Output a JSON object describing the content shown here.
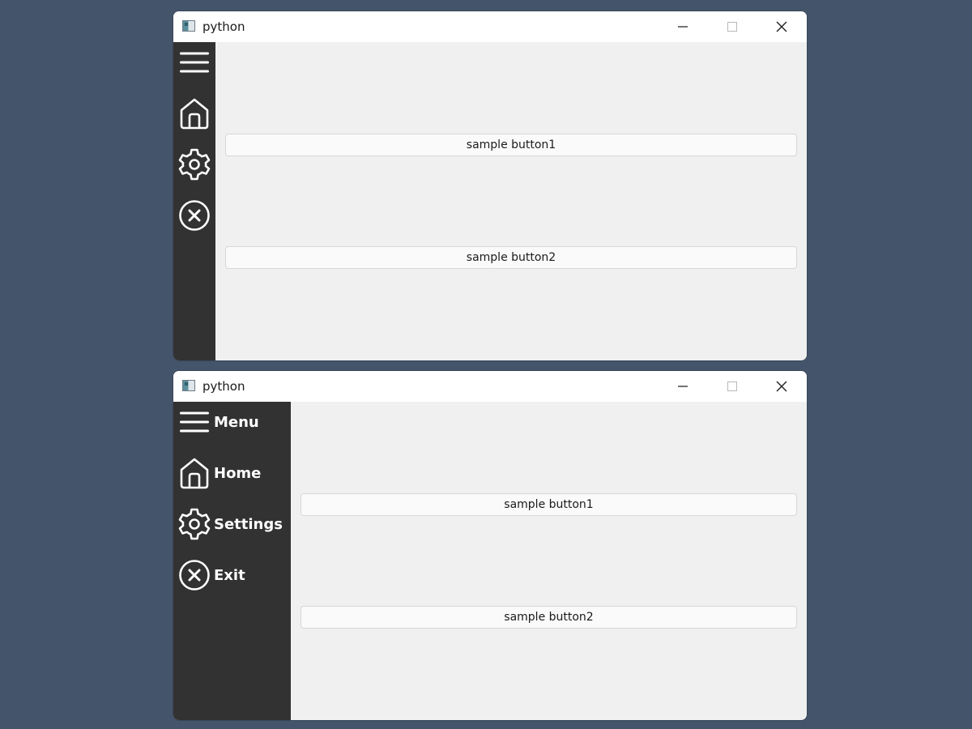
{
  "windows": [
    {
      "title": "python",
      "sidebar_state": "collapsed",
      "nav": [
        {
          "icon": "menu-icon",
          "label": ""
        },
        {
          "icon": "home-icon",
          "label": ""
        },
        {
          "icon": "settings-icon",
          "label": ""
        },
        {
          "icon": "exit-icon",
          "label": ""
        }
      ],
      "buttons": [
        "sample button1",
        "sample button2"
      ]
    },
    {
      "title": "python",
      "sidebar_state": "expanded",
      "nav": [
        {
          "icon": "menu-icon",
          "label": "Menu"
        },
        {
          "icon": "home-icon",
          "label": "Home"
        },
        {
          "icon": "settings-icon",
          "label": "Settings"
        },
        {
          "icon": "exit-icon",
          "label": "Exit"
        }
      ],
      "buttons": [
        "sample button1",
        "sample button2"
      ]
    }
  ],
  "colors": {
    "desktop": "#44546a",
    "sidebar": "#323232",
    "content": "#f0f0f0",
    "titlebar": "#ffffff",
    "icon": "#ffffff"
  }
}
